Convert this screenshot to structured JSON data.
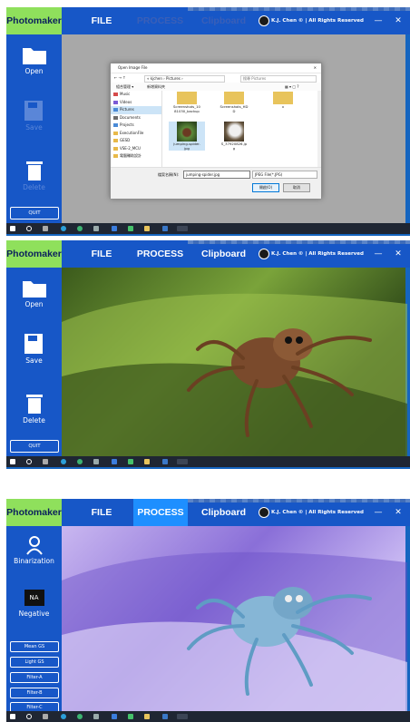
{
  "app": {
    "logo": "Photomaker",
    "menu": [
      "FILE",
      "PROCESS",
      "Clipboard"
    ],
    "credit": "K.J. Chen  © | All Rights Reserved",
    "minimize": "—",
    "close": "✕"
  },
  "file_sidebar": {
    "open": "Open",
    "save": "Save",
    "delete": "Delete",
    "quit": "QUIT"
  },
  "process_sidebar": {
    "binarization": "Binarization",
    "na_badge": "NA",
    "negative": "Negative",
    "buttons": [
      "Mean GS",
      "Light GS",
      "Filter-A",
      "Filter-B",
      "Filter-C"
    ]
  },
  "dialog": {
    "title": "Open Image File",
    "path": "«  kjchen  ›  Pictures  ›",
    "search_placeholder": "搜尋 Pictures",
    "organize": "組合管理 ▾",
    "new_folder": "新增資料夾",
    "nav_items": [
      "Music",
      "Videos",
      "Pictures",
      "Documents",
      "Projects",
      "ExecutionFile",
      "GESD",
      "VSE-2_MCU",
      "電腦輔助設計"
    ],
    "files": [
      {
        "name": "Screenshots_1081030_backup",
        "label1": "Screenshots_10",
        "label2": "81030_backup"
      },
      {
        "name": "Screenshots_HDD",
        "label1": "Screenshots_HD",
        "label2": "D"
      },
      {
        "name": "x",
        "label1": "x",
        "label2": ""
      },
      {
        "name": "jumping-spider.jpg",
        "label1": "jumping-spider.",
        "label2": "jpg"
      },
      {
        "name": "S_37920826.jpg",
        "label1": "S_37920826.jp",
        "label2": "g"
      }
    ],
    "filename_label": "檔案名稱(N):",
    "filename_value": "jumping-spider.jpg",
    "filetype_value": "JPEG File(*.JPG)",
    "open_btn": "開啟(O)",
    "cancel_btn": "取消"
  },
  "colors": {
    "chrome_blue": "#1757c7",
    "logo_green": "#8fe05c",
    "active_tab": "#1e8fff"
  }
}
